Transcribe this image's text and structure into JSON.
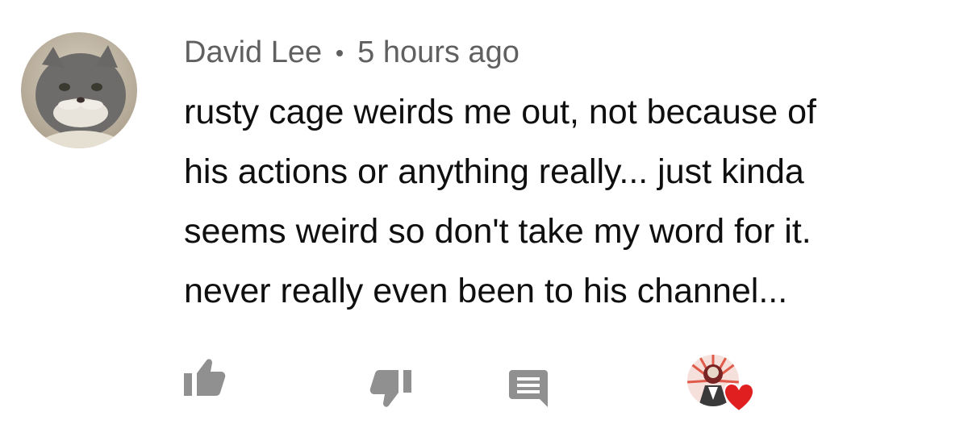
{
  "comment": {
    "author": "David Lee",
    "timestamp": "5 hours ago",
    "text_lines": [
      "rusty cage weirds me out, not because of",
      "his actions or anything really... just kinda",
      "seems weird so don't take my word for it.",
      "never really even been to his channel..."
    ],
    "avatar": "cat-avatar"
  },
  "actions": {
    "like_icon": "thumbs-up-icon",
    "dislike_icon": "thumbs-down-icon",
    "reply_icon": "comment-reply-icon",
    "creator_heart_icon": "creator-heart-icon"
  },
  "colors": {
    "meta_text": "#606060",
    "body_text": "#0f0f0f",
    "icon": "#909090",
    "heart": "#e02020"
  }
}
